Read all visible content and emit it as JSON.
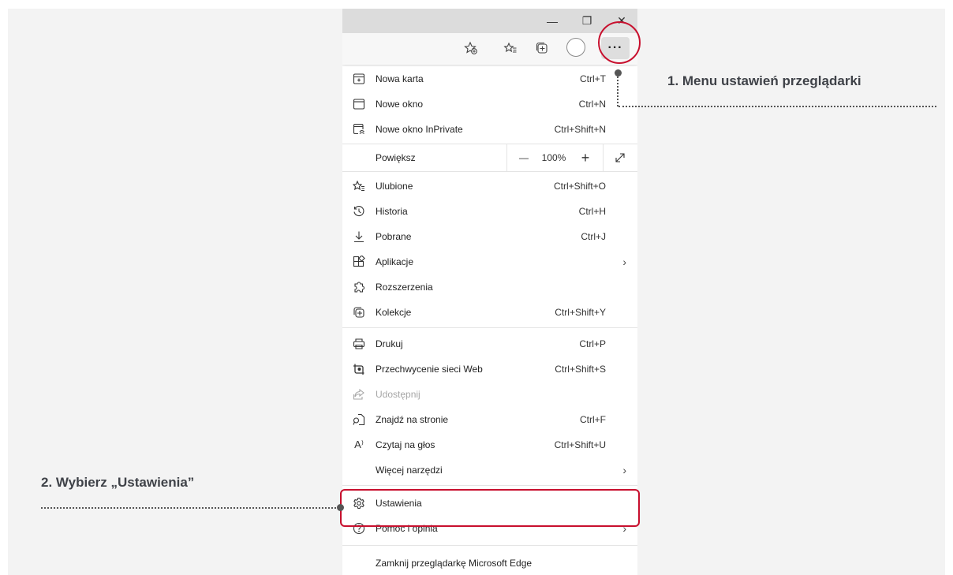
{
  "window": {
    "minimize_glyph": "—",
    "restore_glyph": "❐",
    "close_glyph": "✕"
  },
  "toolbar": {
    "more_label": "···"
  },
  "menu": {
    "items": [
      {
        "label": "Nowa karta",
        "shortcut": "Ctrl+T",
        "icon": "new-tab-icon"
      },
      {
        "label": "Nowe okno",
        "shortcut": "Ctrl+N",
        "icon": "new-window-icon"
      },
      {
        "label": "Nowe okno InPrivate",
        "shortcut": "Ctrl+Shift+N",
        "icon": "inprivate-icon"
      },
      {
        "label": "Ulubione",
        "shortcut": "Ctrl+Shift+O",
        "icon": "favorites-icon"
      },
      {
        "label": "Historia",
        "shortcut": "Ctrl+H",
        "icon": "history-icon"
      },
      {
        "label": "Pobrane",
        "shortcut": "Ctrl+J",
        "icon": "download-icon"
      },
      {
        "label": "Aplikacje",
        "shortcut": "",
        "icon": "apps-icon"
      },
      {
        "label": "Rozszerzenia",
        "shortcut": "",
        "icon": "extensions-icon"
      },
      {
        "label": "Kolekcje",
        "shortcut": "Ctrl+Shift+Y",
        "icon": "collections-icon"
      },
      {
        "label": "Drukuj",
        "shortcut": "Ctrl+P",
        "icon": "print-icon"
      },
      {
        "label": "Przechwycenie sieci Web",
        "shortcut": "Ctrl+Shift+S",
        "icon": "web-capture-icon"
      },
      {
        "label": "Udostępnij",
        "shortcut": "",
        "icon": "share-icon"
      },
      {
        "label": "Znajdź na stronie",
        "shortcut": "Ctrl+F",
        "icon": "find-icon"
      },
      {
        "label": "Czytaj na głos",
        "shortcut": "Ctrl+Shift+U",
        "icon": "read-aloud-icon"
      },
      {
        "label": "Więcej narzędzi",
        "shortcut": "",
        "icon": ""
      },
      {
        "label": "Ustawienia",
        "shortcut": "",
        "icon": "gear-icon"
      },
      {
        "label": "Pomoc i opinia",
        "shortcut": "",
        "icon": "help-icon"
      },
      {
        "label": "Zamknij przeglądarkę Microsoft Edge",
        "shortcut": "",
        "icon": ""
      }
    ],
    "zoom": {
      "label": "Powiększ",
      "minus": "—",
      "value": "100%",
      "plus": "+"
    },
    "arrow_glyph": "›",
    "read_aloud_glyph": "A⁾"
  },
  "annotations": {
    "step1": "1. Menu ustawień przeglądarki",
    "step2": "2. Wybierz „Ustawienia”",
    "highlight_color": "#c8102e"
  }
}
